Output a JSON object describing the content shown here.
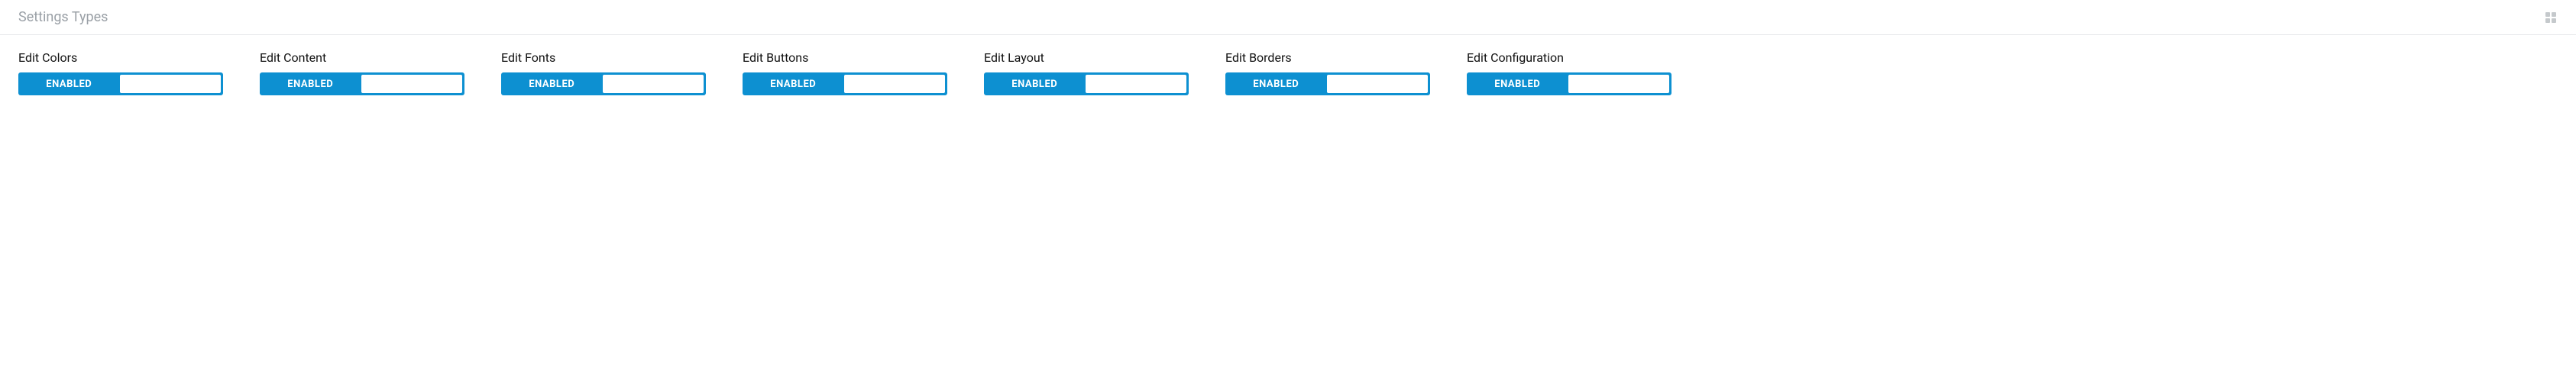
{
  "panel": {
    "title": "Settings Types"
  },
  "toggle_label_enabled": "ENABLED",
  "settings": [
    {
      "label": "Edit Colors",
      "state": "ENABLED"
    },
    {
      "label": "Edit Content",
      "state": "ENABLED"
    },
    {
      "label": "Edit Fonts",
      "state": "ENABLED"
    },
    {
      "label": "Edit Buttons",
      "state": "ENABLED"
    },
    {
      "label": "Edit Layout",
      "state": "ENABLED"
    },
    {
      "label": "Edit Borders",
      "state": "ENABLED"
    },
    {
      "label": "Edit Configuration",
      "state": "ENABLED"
    }
  ]
}
